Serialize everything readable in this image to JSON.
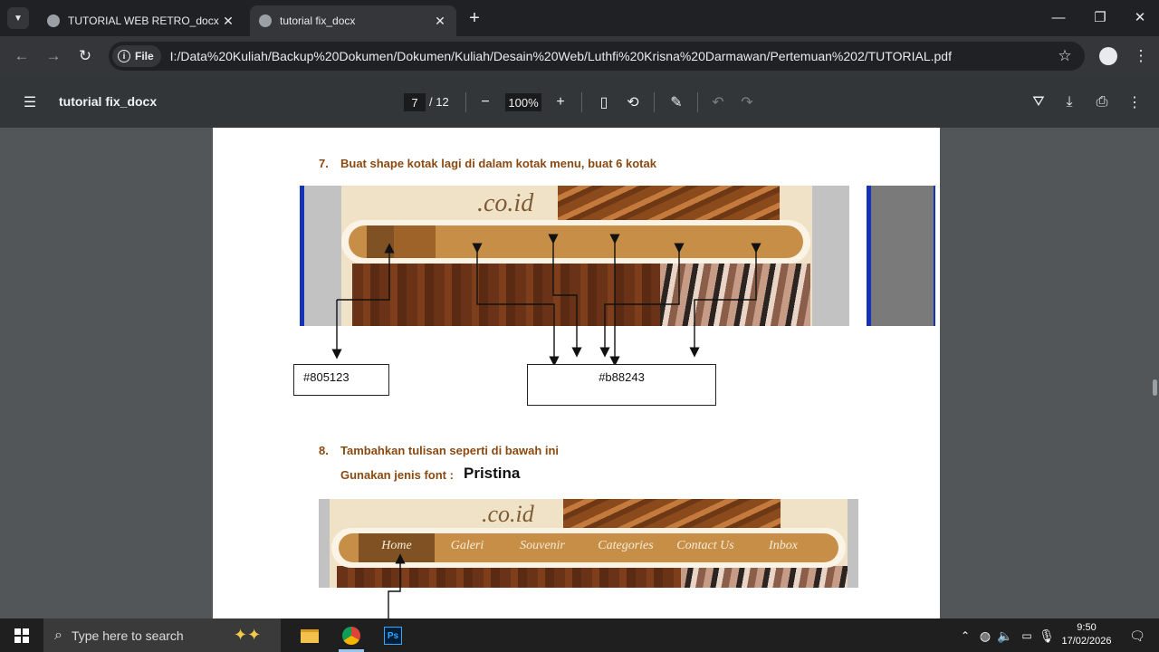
{
  "tabs": [
    {
      "title": "TUTORIAL WEB RETRO_docx",
      "close": "✕"
    },
    {
      "title": "tutorial fix_docx",
      "close": "✕"
    }
  ],
  "new_tab": "+",
  "window": {
    "minimize": "—",
    "restore": "❐",
    "close": "✕"
  },
  "address": {
    "chip_label": "File",
    "url": "I:/Data%20Kuliah/Backup%20Dokumen/Dokumen/Kuliah/Desain%20Web/Luthfi%20Krisna%20Darmawan/Pertemuan%202/TUTORIAL.pdf"
  },
  "pdf_toolbar": {
    "title": "tutorial fix_docx",
    "page_current": "7",
    "page_total": "/ 12",
    "zoom": "100%"
  },
  "document": {
    "step7": {
      "number": "7.",
      "text": "Buat shape kotak lagi di dalam kotak menu, buat 6 kotak"
    },
    "hex_dark": "#805123",
    "hex_light": "#b88243",
    "step8": {
      "number": "8.",
      "text": "Tambahkan tulisan seperti di bawah ini"
    },
    "font_hint": "Gunakan jenis font :",
    "font_name": "Pristina",
    "logo_text": ".co.id",
    "menu_items": [
      "Home",
      "Galeri",
      "Souvenir",
      "Categories",
      "Contact Us",
      "Inbox"
    ]
  },
  "taskbar": {
    "search_placeholder": "Type here to search",
    "time": "9:50",
    "date": "17/02/2026"
  },
  "colors": {
    "menu_dark": "#805123",
    "menu_light": "#b88243",
    "heading": "#8a4a12"
  }
}
